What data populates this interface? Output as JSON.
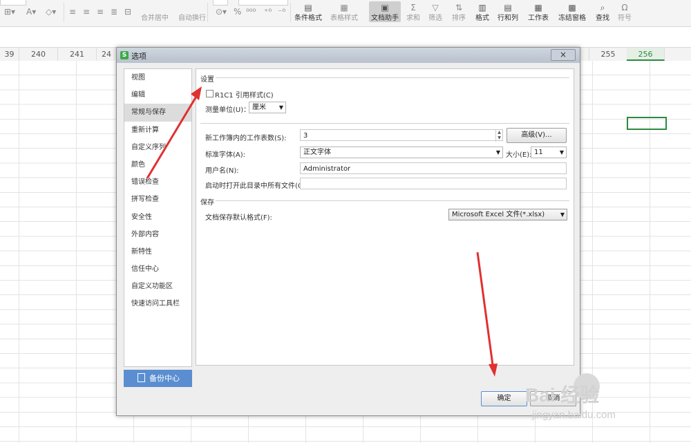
{
  "ribbon": {
    "merge_center": "合并居中",
    "auto_wrap": "自动换行",
    "cond_format": "条件格式",
    "table_style": "表格样式",
    "doc_helper": "文档助手",
    "sum": "求和",
    "filter": "筛选",
    "sort": "排序",
    "format": "格式",
    "row_col": "行和列",
    "worksheet": "工作表",
    "freeze_pane": "冻结窗格",
    "find": "查找",
    "symbol": "符号"
  },
  "columns": [
    "39",
    "240",
    "241",
    "24",
    "255",
    "256"
  ],
  "dialog": {
    "title": "选项",
    "close": "×",
    "nav": [
      "视图",
      "编辑",
      "常规与保存",
      "重新计算",
      "自定义序列",
      "颜色",
      "错误检查",
      "拼写检查",
      "安全性",
      "外部内容",
      "新特性",
      "信任中心",
      "自定义功能区",
      "快速访问工具栏"
    ],
    "nav_selected_index": 2,
    "backup_center": "备份中心",
    "settings_section": "设置",
    "r1c1_label": "R1C1 引用样式(C)",
    "measure_label": "测量单位(U)：",
    "measure_value": "厘米",
    "sheets_label": "新工作簿内的工作表数(S):",
    "sheets_value": "3",
    "advanced_btn": "高级(V)...",
    "std_font_label": "标准字体(A):",
    "std_font_value": "正文字体",
    "size_label": "大小(E):",
    "size_value": "11",
    "username_label": "用户名(N):",
    "username_value": "Administrator",
    "startup_label": "启动时打开此目录中所有文件(O):",
    "startup_value": "",
    "save_section": "保存",
    "save_format_label": "文档保存默认格式(F):",
    "save_format_value": "Microsoft Excel 文件(*.xlsx)",
    "ok_btn": "确定",
    "cancel_btn": "取消"
  },
  "watermark": {
    "brand": "Bai 经验",
    "url": "jingyan.baidu.com"
  },
  "colors": {
    "accent_green": "#2b8a3e",
    "backup_blue": "#5a8ed0",
    "annotation_red": "#e03030"
  }
}
